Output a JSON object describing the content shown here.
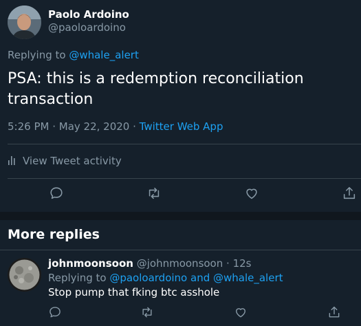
{
  "tweet": {
    "author_name": "Paolo Ardoino",
    "author_handle": "@paoloardoino",
    "replying_prefix": "Replying to ",
    "replying_to": "@whale_alert",
    "text": "PSA: this is a redemption reconciliation transaction",
    "time": "5:26 PM",
    "date": "May 22, 2020",
    "separator": " · ",
    "source": "Twitter Web App",
    "activity_label": "View Tweet activity"
  },
  "more_replies": {
    "title": "More replies",
    "reply": {
      "author_name": "johnmoonsoon",
      "author_handle": "@johnmoonsoon",
      "age": "12s",
      "age_separator": " · ",
      "replying_prefix": "Replying to ",
      "replying_to_1": "@paoloardoino",
      "and": " and ",
      "replying_to_2": "@whale_alert",
      "text": "Stop pump that fking btc asshole"
    }
  },
  "icons": [
    "reply-icon",
    "retweet-icon",
    "like-icon",
    "share-icon",
    "activity-chart-icon"
  ],
  "colors": {
    "background": "#15202b",
    "accent": "#1da1f2",
    "muted": "#8899a6",
    "divider": "#38444d"
  }
}
